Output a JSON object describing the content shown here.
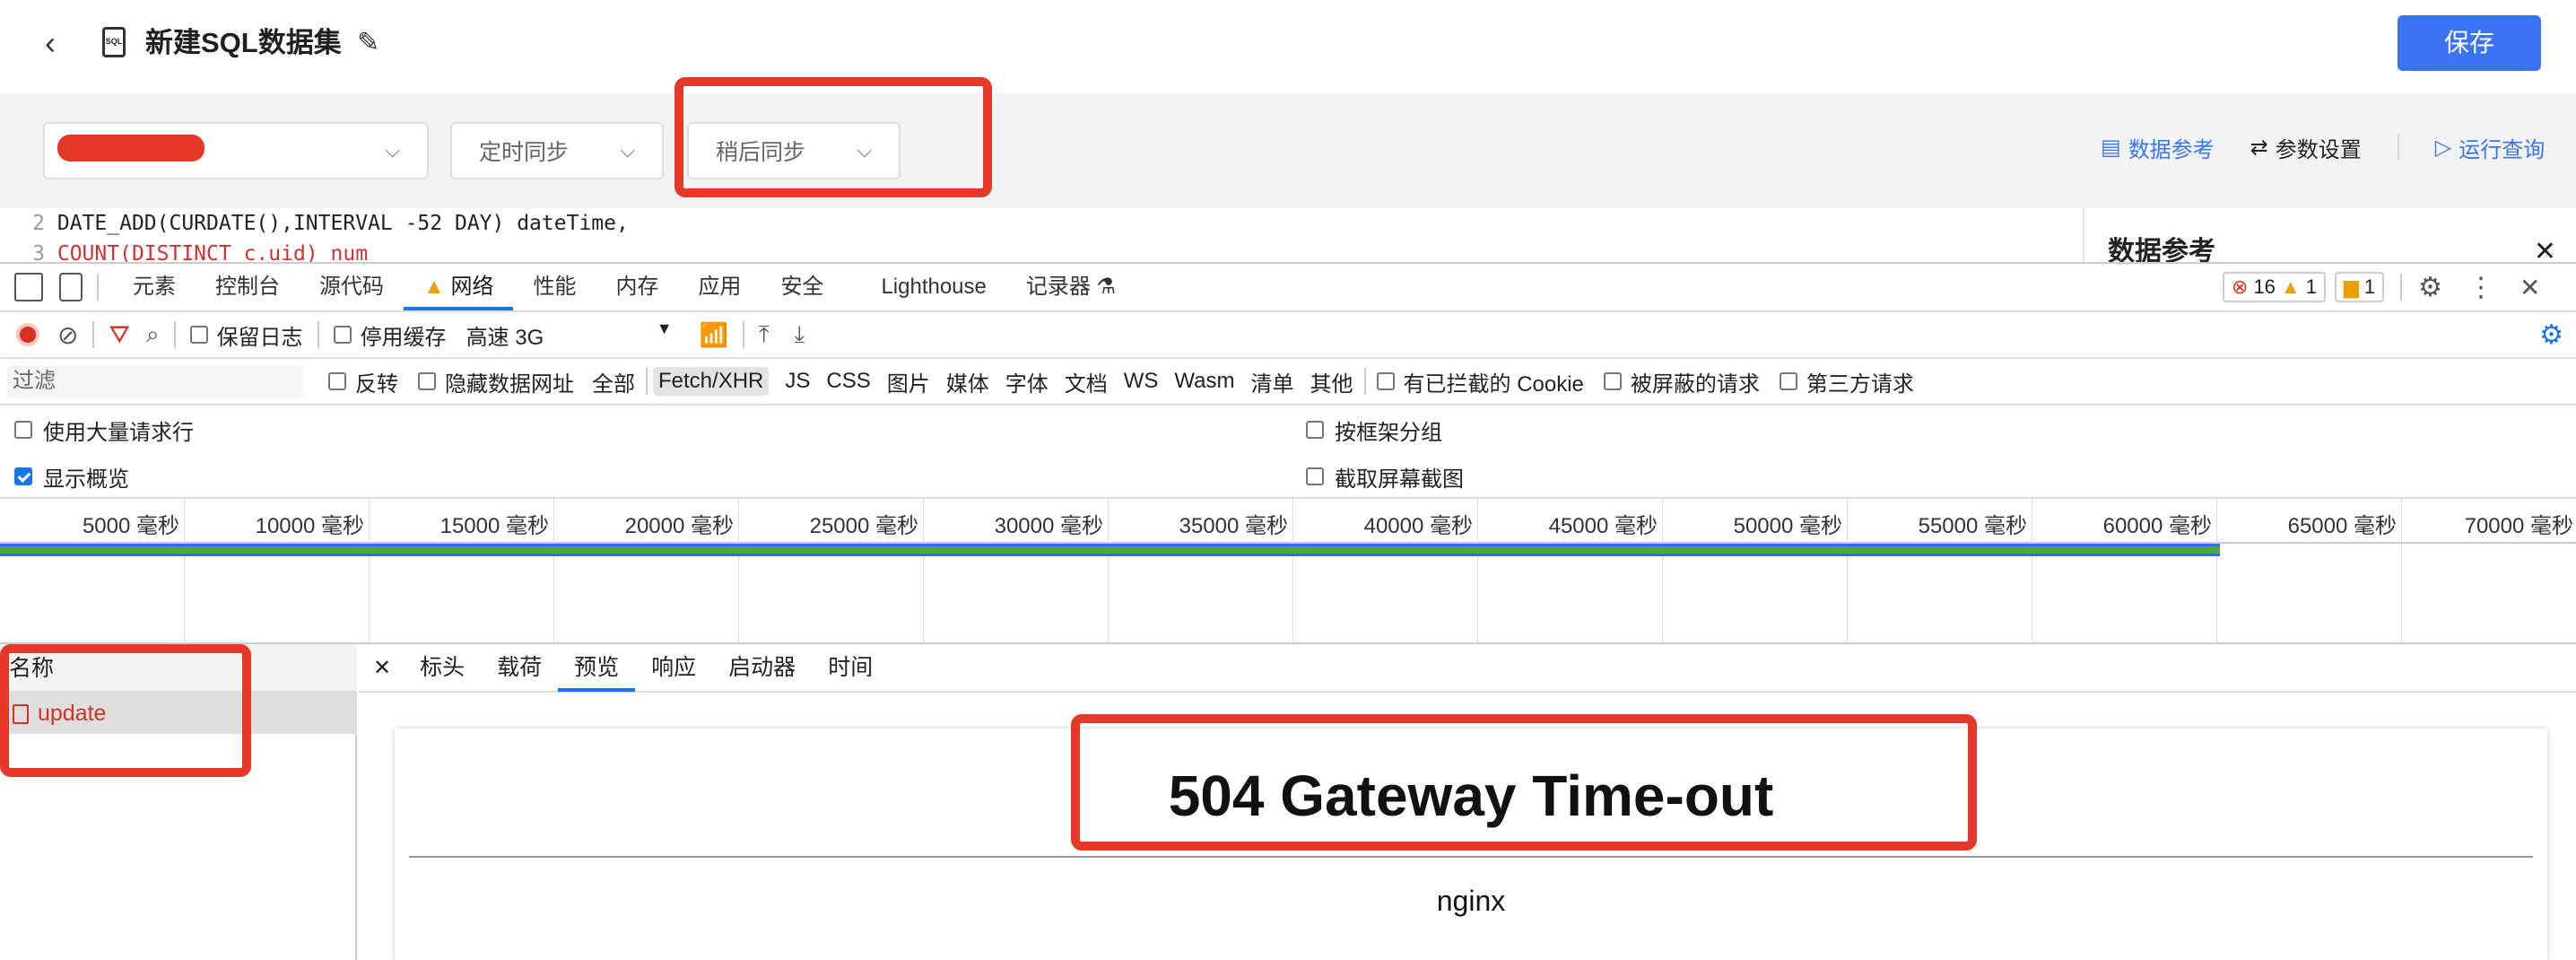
{
  "header": {
    "back_icon": "chevron-left-icon",
    "doc_icon_text": "SQL",
    "title": "新建SQL数据集",
    "edit_icon": "pencil-icon",
    "save_label": "保存"
  },
  "toolbar": {
    "sync_select": "定时同步",
    "later_select": "稍后同步",
    "links": [
      "数据参考",
      "参数设置",
      "运行查询"
    ]
  },
  "editor": {
    "lines": [
      {
        "num": "2",
        "text": "DATE_ADD(CURDATE(),INTERVAL -52 DAY) dateTime,"
      },
      {
        "num": "3",
        "text": "COUNT(DISTINCT c.uid) num"
      }
    ],
    "side_title": "数据参考"
  },
  "devtools": {
    "tabs": [
      "元素",
      "控制台",
      "源代码",
      "网络",
      "性能",
      "内存",
      "应用",
      "安全",
      "Lighthouse",
      "记录器"
    ],
    "active_tab": "网络",
    "error_count": "16",
    "warning_count": "1",
    "issue_count": "1"
  },
  "network": {
    "preserve_log": "保留日志",
    "disable_cache": "停用缓存",
    "throttle": "高速 3G",
    "filter_placeholder": "过滤",
    "filter_options": [
      "反转",
      "隐藏数据网址",
      "全部",
      "Fetch/XHR",
      "JS",
      "CSS",
      "图片",
      "媒体",
      "字体",
      "文档",
      "WS",
      "Wasm",
      "清单",
      "其他"
    ],
    "blocked_cookie": "有已拦截的 Cookie",
    "blocked_req": "被屏蔽的请求",
    "third_party": "第三方请求",
    "large_rows": "使用大量请求行",
    "group_by_frame": "按框架分组",
    "show_overview": "显示概览",
    "capture_screens": "截取屏幕截图",
    "timeline_ticks": [
      "5000 毫秒",
      "10000 毫秒",
      "15000 毫秒",
      "20000 毫秒",
      "25000 毫秒",
      "30000 毫秒",
      "35000 毫秒",
      "40000 毫秒",
      "45000 毫秒",
      "50000 毫秒",
      "55000 毫秒",
      "60000 毫秒",
      "65000 毫秒",
      "70000 毫秒"
    ],
    "name_header": "名称",
    "request_name": "update",
    "detail_tabs": [
      "标头",
      "载荷",
      "预览",
      "响应",
      "启动器",
      "时间"
    ],
    "active_detail": "预览",
    "preview_title": "504 Gateway Time-out",
    "preview_server": "nginx"
  },
  "colors": {
    "primary": "#3a74f2",
    "annotation": "#e53828",
    "devtools_blue": "#1a73e8"
  }
}
